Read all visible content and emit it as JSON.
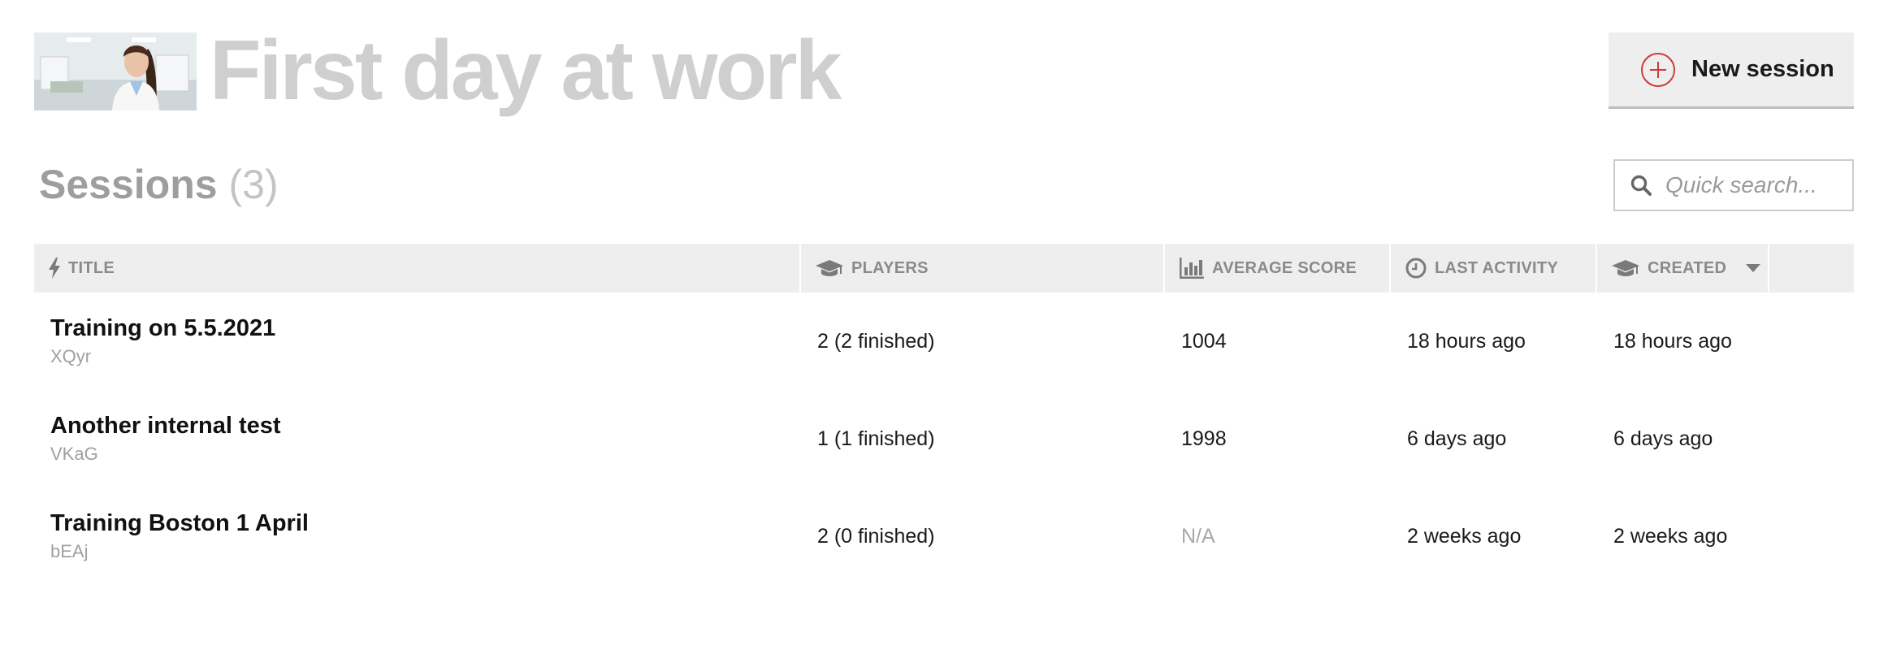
{
  "header": {
    "title": "First day at work",
    "new_session_label": "New session"
  },
  "sessions": {
    "heading": "Sessions",
    "count": "(3)"
  },
  "search": {
    "placeholder": "Quick search..."
  },
  "table": {
    "columns": [
      {
        "label": "TITLE",
        "icon": "lightning-icon"
      },
      {
        "label": "PLAYERS",
        "icon": "graduation-cap-icon"
      },
      {
        "label": "AVERAGE SCORE",
        "icon": "bar-chart-icon"
      },
      {
        "label": "LAST ACTIVITY",
        "icon": "clock-icon"
      },
      {
        "label": "CREATED",
        "icon": "graduation-cap-icon",
        "sort": "descending"
      }
    ],
    "rows": [
      {
        "title": "Training on 5.5.2021",
        "code": "XQyr",
        "players": "2 (2 finished)",
        "average_score": "1004",
        "last_activity": "18 hours ago",
        "created": "18 hours ago"
      },
      {
        "title": "Another internal test",
        "code": "VKaG",
        "players": "1 (1 finished)",
        "average_score": "1998",
        "last_activity": "6 days ago",
        "created": "6 days ago"
      },
      {
        "title": "Training Boston 1 April",
        "code": "bEAj",
        "players": "2 (0 finished)",
        "average_score": "N/A",
        "last_activity": "2 weeks ago",
        "created": "2 weeks ago"
      }
    ]
  },
  "colors": {
    "accent": "#d03a3a",
    "title_gray": "#cfcfcf",
    "header_bg": "#eeeeee"
  }
}
